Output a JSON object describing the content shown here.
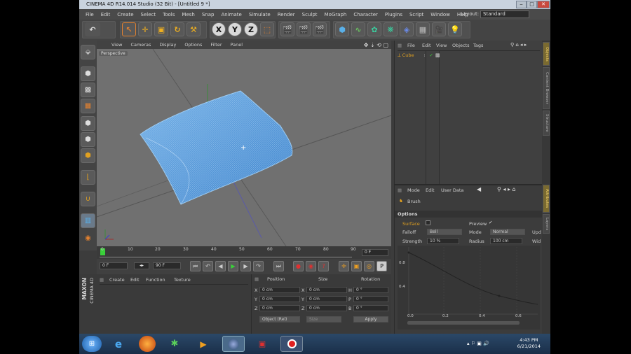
{
  "window": {
    "title": "CINEMA 4D R14.014 Studio (32 Bit) - [Untitled 9 *]",
    "min": "‒",
    "max": "□",
    "close": "✕"
  },
  "menu": [
    "File",
    "Edit",
    "Create",
    "Select",
    "Tools",
    "Mesh",
    "Snap",
    "Animate",
    "Simulate",
    "Render",
    "Sculpt",
    "MoGraph",
    "Character",
    "Plugins",
    "Script",
    "Window",
    "Help"
  ],
  "layout": {
    "label": "Layout:",
    "value": "Standard"
  },
  "toolbar": {
    "axes": [
      "X",
      "Y",
      "Z"
    ]
  },
  "viewport": {
    "menu": [
      "View",
      "Cameras",
      "Display",
      "Options",
      "Filter",
      "Panel"
    ],
    "camera": "Perspective"
  },
  "timeline": {
    "ticks": [
      "0",
      "10",
      "20",
      "30",
      "40",
      "50",
      "60",
      "70",
      "80",
      "90"
    ],
    "frame": "0 F"
  },
  "transport": {
    "start": "0 F",
    "end": "90 F"
  },
  "materials": {
    "menu": [
      "Create",
      "Edit",
      "Function",
      "Texture"
    ]
  },
  "coords": {
    "headers": [
      "Position",
      "Size",
      "Rotation"
    ],
    "rows": [
      {
        "axis": "X",
        "pos": "0 cm",
        "size": "0 cm",
        "rot_label": "H",
        "rot": "0 °"
      },
      {
        "axis": "Y",
        "pos": "0 cm",
        "size": "0 cm",
        "rot_label": "P",
        "rot": "0 °"
      },
      {
        "axis": "Z",
        "pos": "0 cm",
        "size": "0 cm",
        "rot_label": "B",
        "rot": "0 °"
      }
    ],
    "mode": "Object (Rel)",
    "size_mode": "Size",
    "apply": "Apply"
  },
  "objects": {
    "menu": [
      "File",
      "Edit",
      "View",
      "Objects",
      "Tags"
    ],
    "item": "Cube"
  },
  "attributes": {
    "menu": [
      "Mode",
      "Edit",
      "User Data"
    ],
    "tool": "Brush",
    "section": "Options",
    "surface": "Surface",
    "preview": "Preview",
    "falloff_label": "Falloff",
    "falloff": "Bell",
    "mode_label": "Mode",
    "mode": "Normal",
    "strength_label": "Strength",
    "strength": "10 %",
    "radius_label": "Radius",
    "radius": "100 cm",
    "upd": "Upd",
    "wid": "Wid",
    "graph_y": [
      "0.8",
      "0.4"
    ],
    "graph_x": [
      "0.0",
      "0.2",
      "0.4",
      "0.6"
    ]
  },
  "right_tabs": [
    "Objects",
    "Content Browser",
    "Structure",
    "Attributes",
    "Layers"
  ],
  "maxon": {
    "brand": "MAXON",
    "product": "CINEMA 4D"
  },
  "clock": {
    "time": "4:43 PM",
    "date": "6/21/2014"
  }
}
